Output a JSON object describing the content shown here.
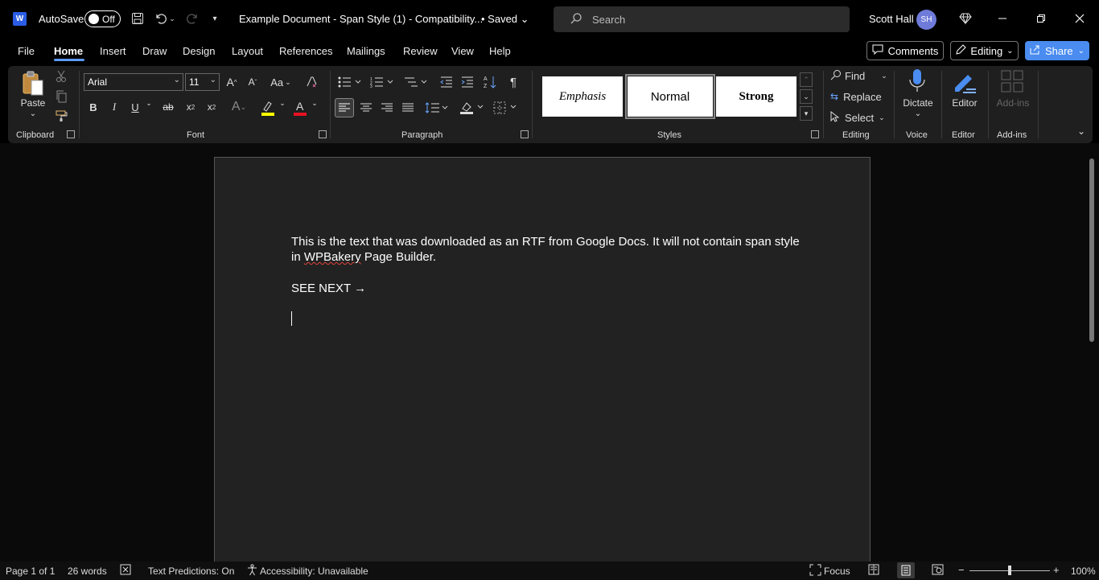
{
  "titlebar": {
    "app_letter": "W",
    "autosave_label": "AutoSave",
    "autosave_state": "Off",
    "document_title": "Example Document - Span Style (1)  -  Compatibility...",
    "save_status": "• Saved",
    "search_placeholder": "Search",
    "user_name": "Scott Hall",
    "user_initials": "SH"
  },
  "menu": {
    "tabs": [
      "File",
      "Home",
      "Insert",
      "Draw",
      "Design",
      "Layout",
      "References",
      "Mailings",
      "Review",
      "View",
      "Help"
    ],
    "active_tab": "Home",
    "comments_label": "Comments",
    "editing_label": "Editing",
    "share_label": "Share"
  },
  "ribbon": {
    "clipboard": {
      "paste_label": "Paste",
      "group_label": "Clipboard"
    },
    "font": {
      "font_name": "Arial",
      "font_size": "11",
      "change_case": "Aa",
      "group_label": "Font"
    },
    "paragraph": {
      "group_label": "Paragraph"
    },
    "styles": {
      "items": [
        "Emphasis",
        "Normal",
        "Strong"
      ],
      "group_label": "Styles"
    },
    "editing": {
      "find_label": "Find",
      "replace_label": "Replace",
      "select_label": "Select",
      "group_label": "Editing"
    },
    "voice": {
      "dictate_label": "Dictate",
      "group_label": "Voice"
    },
    "editor": {
      "editor_label": "Editor",
      "group_label": "Editor"
    },
    "addins": {
      "addins_label": "Add-ins",
      "group_label": "Add-ins"
    }
  },
  "document": {
    "paragraph1_part1": "This is the text that was downloaded as an RTF from Google Docs. It will not contain span style",
    "paragraph1_part2a": "in ",
    "paragraph1_misspelled": "WPBakery",
    "paragraph1_part2b": " Page Builder.",
    "paragraph2": "SEE NEXT →"
  },
  "statusbar": {
    "page": "Page 1 of 1",
    "words": "26 words",
    "text_predictions": "Text Predictions: On",
    "accessibility": "Accessibility: Unavailable",
    "focus": "Focus",
    "zoom": "100%"
  },
  "colors": {
    "accent": "#4a8cf0",
    "highlight": "#ffff00",
    "font_color": "#e81123"
  }
}
